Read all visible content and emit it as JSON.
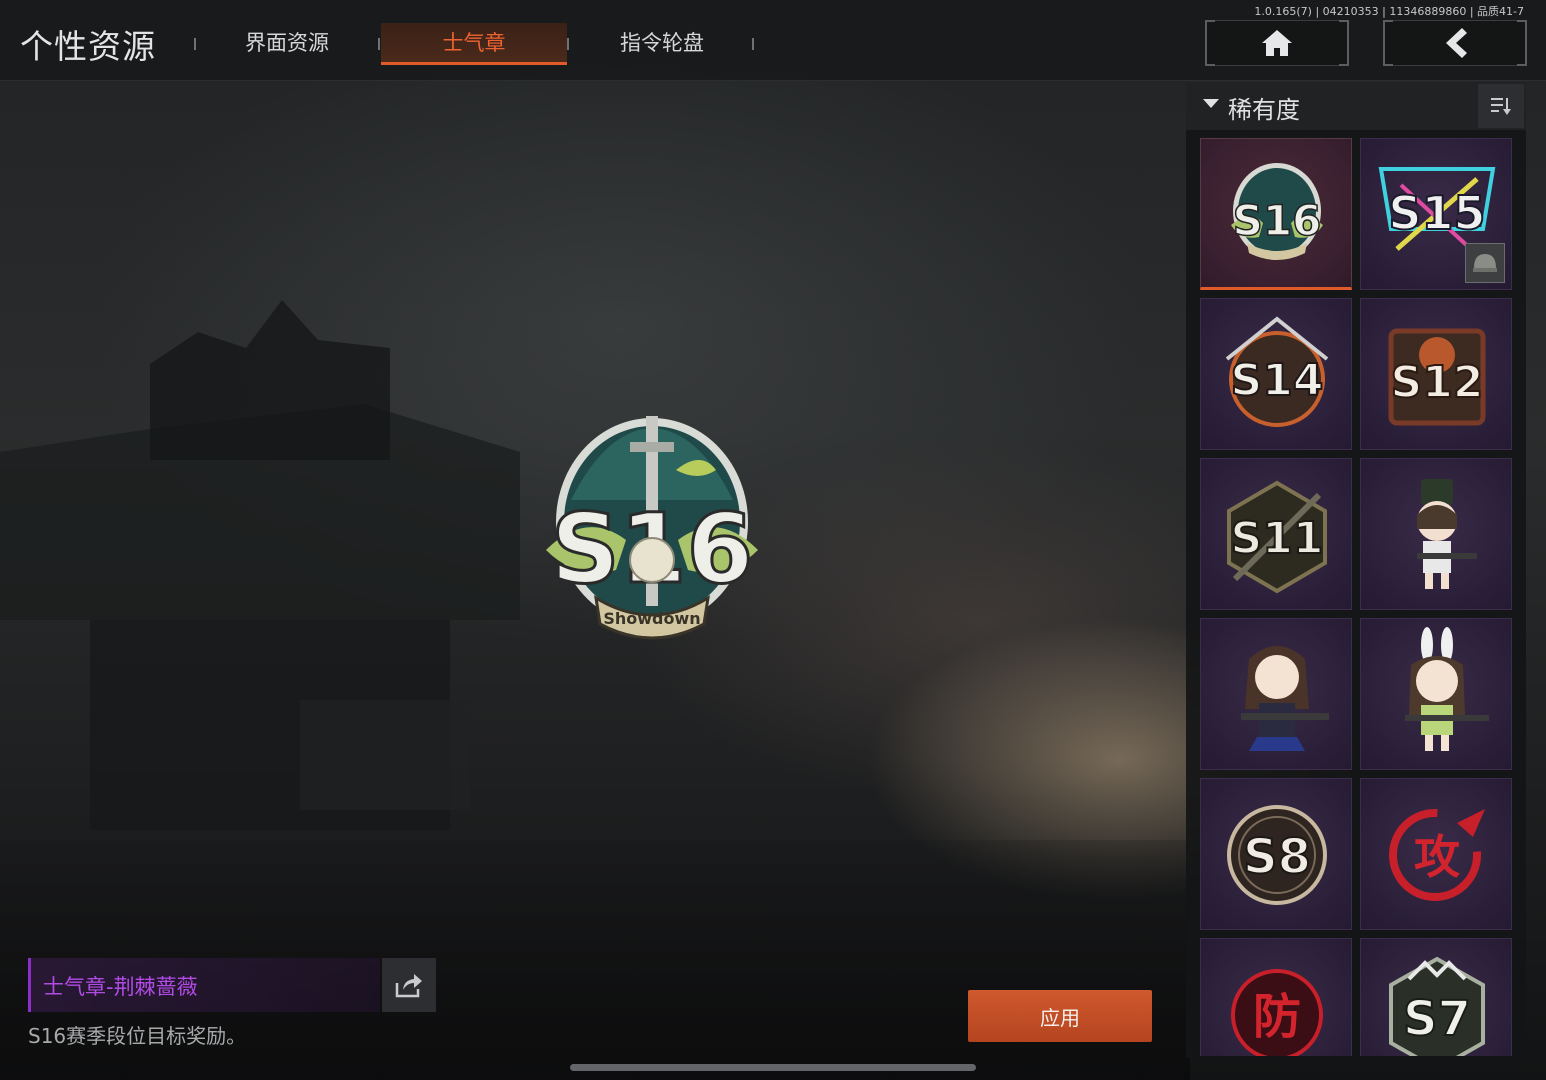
{
  "header": {
    "page_title": "个性资源",
    "tabs": [
      {
        "label": "界面资源",
        "active": false
      },
      {
        "label": "士气章",
        "active": true
      },
      {
        "label": "指令轮盘",
        "active": false
      }
    ],
    "version_text": "1.0.165(7) | 04210353 | 11346889860 | 品质41-7",
    "home_icon": "home-icon",
    "back_icon": "chevron-left-icon"
  },
  "panel": {
    "sort_label": "稀有度",
    "sort_icon": "sort-icon",
    "tiles": [
      {
        "label": "S16",
        "selected": true
      },
      {
        "label": "S15",
        "selected": false,
        "equipped_icon": "helmet-icon"
      },
      {
        "label": "S14",
        "selected": false
      },
      {
        "label": "S12",
        "selected": false
      },
      {
        "label": "S11",
        "selected": false
      },
      {
        "label": "",
        "selected": false,
        "icon": "chibi-soldier-icon"
      },
      {
        "label": "",
        "selected": false,
        "icon": "chibi-girl-rifle-icon"
      },
      {
        "label": "",
        "selected": false,
        "icon": "chibi-bunny-girl-icon"
      },
      {
        "label": "S8",
        "selected": false
      },
      {
        "label": "攻",
        "selected": false
      },
      {
        "label": "防",
        "selected": false
      },
      {
        "label": "S7",
        "selected": false
      }
    ]
  },
  "preview": {
    "emblem_label": "S16",
    "emblem_ribbon": "Showdown"
  },
  "detail": {
    "item_name": "士气章-荆棘蔷薇",
    "description": "S16赛季段位目标奖励。",
    "apply_label": "应用",
    "share_icon": "share-icon"
  },
  "colors": {
    "accent": "#e05a2a",
    "rarity_purple": "#b14be6",
    "tile_bg": "#2a1f38"
  }
}
